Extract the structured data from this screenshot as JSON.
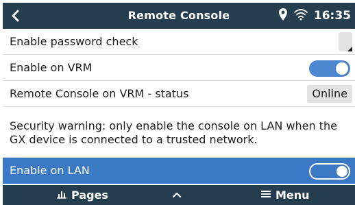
{
  "header": {
    "title": "Remote Console",
    "time": "16:35",
    "back_icon": "chevron-left-icon",
    "location_icon": "location-pin-icon",
    "wifi_icon": "wifi-icon"
  },
  "settings": {
    "password_check": {
      "label": "Enable password check",
      "checked": false
    },
    "vrm": {
      "label": "Enable on VRM",
      "enabled": true
    },
    "vrm_status": {
      "label": "Remote Console on VRM - status",
      "value": "Online"
    },
    "warning": "Security warning: only enable the console on LAN when the GX device is connected to a trusted network.",
    "lan": {
      "label": "Enable on LAN",
      "enabled": true,
      "selected": true
    }
  },
  "footer": {
    "pages_label": "Pages",
    "menu_label": "Menu",
    "pages_icon": "bar-chart-icon",
    "up_icon": "chevron-up-icon",
    "menu_icon": "hamburger-icon"
  },
  "colors": {
    "header_bg": "#243d4f",
    "accent": "#3c79c4",
    "toggle_on": "#4b86cf",
    "pill_bg": "#e2e2e2"
  }
}
